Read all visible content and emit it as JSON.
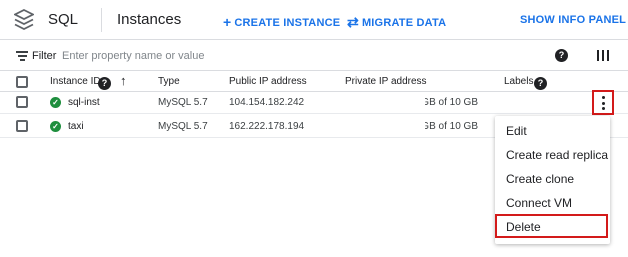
{
  "header": {
    "app_name": "SQL",
    "page_title": "Instances",
    "create_label": "CREATE INSTANCE",
    "migrate_label": "MIGRATE DATA",
    "info_panel_label": "SHOW INFO PANEL"
  },
  "filter": {
    "label": "Filter",
    "placeholder": "Enter property name or value"
  },
  "table": {
    "columns": {
      "instance_id": "Instance ID",
      "type": "Type",
      "public_ip": "Public IP address",
      "private_ip": "Private IP address",
      "labels": "Labels"
    },
    "rows": [
      {
        "id": "sql-inst",
        "type": "MySQL 5.7",
        "public_ip": "104.154.182.242",
        "storage": "GB of 10 GB",
        "status": "running"
      },
      {
        "id": "taxi",
        "type": "MySQL 5.7",
        "public_ip": "162.222.178.194",
        "storage": "GB of 10 GB",
        "status": "running"
      }
    ]
  },
  "menu": {
    "items": [
      "Edit",
      "Create read replica",
      "Create clone",
      "Connect VM",
      "Delete"
    ]
  },
  "icons": {
    "logo": "cloud-sql-logo-icon",
    "create": "plus-icon",
    "migrate": "migrate-arrows-icon",
    "filter": "filter-lines-icon",
    "help": "help-icon",
    "columns": "column-display-icon",
    "sort": "arrow-up-icon",
    "status": "check-circle-icon",
    "more": "more-vert-icon"
  },
  "colors": {
    "accent": "#1a73e8",
    "status_ok": "#1e8e3e",
    "highlight": "#d31a1a"
  }
}
